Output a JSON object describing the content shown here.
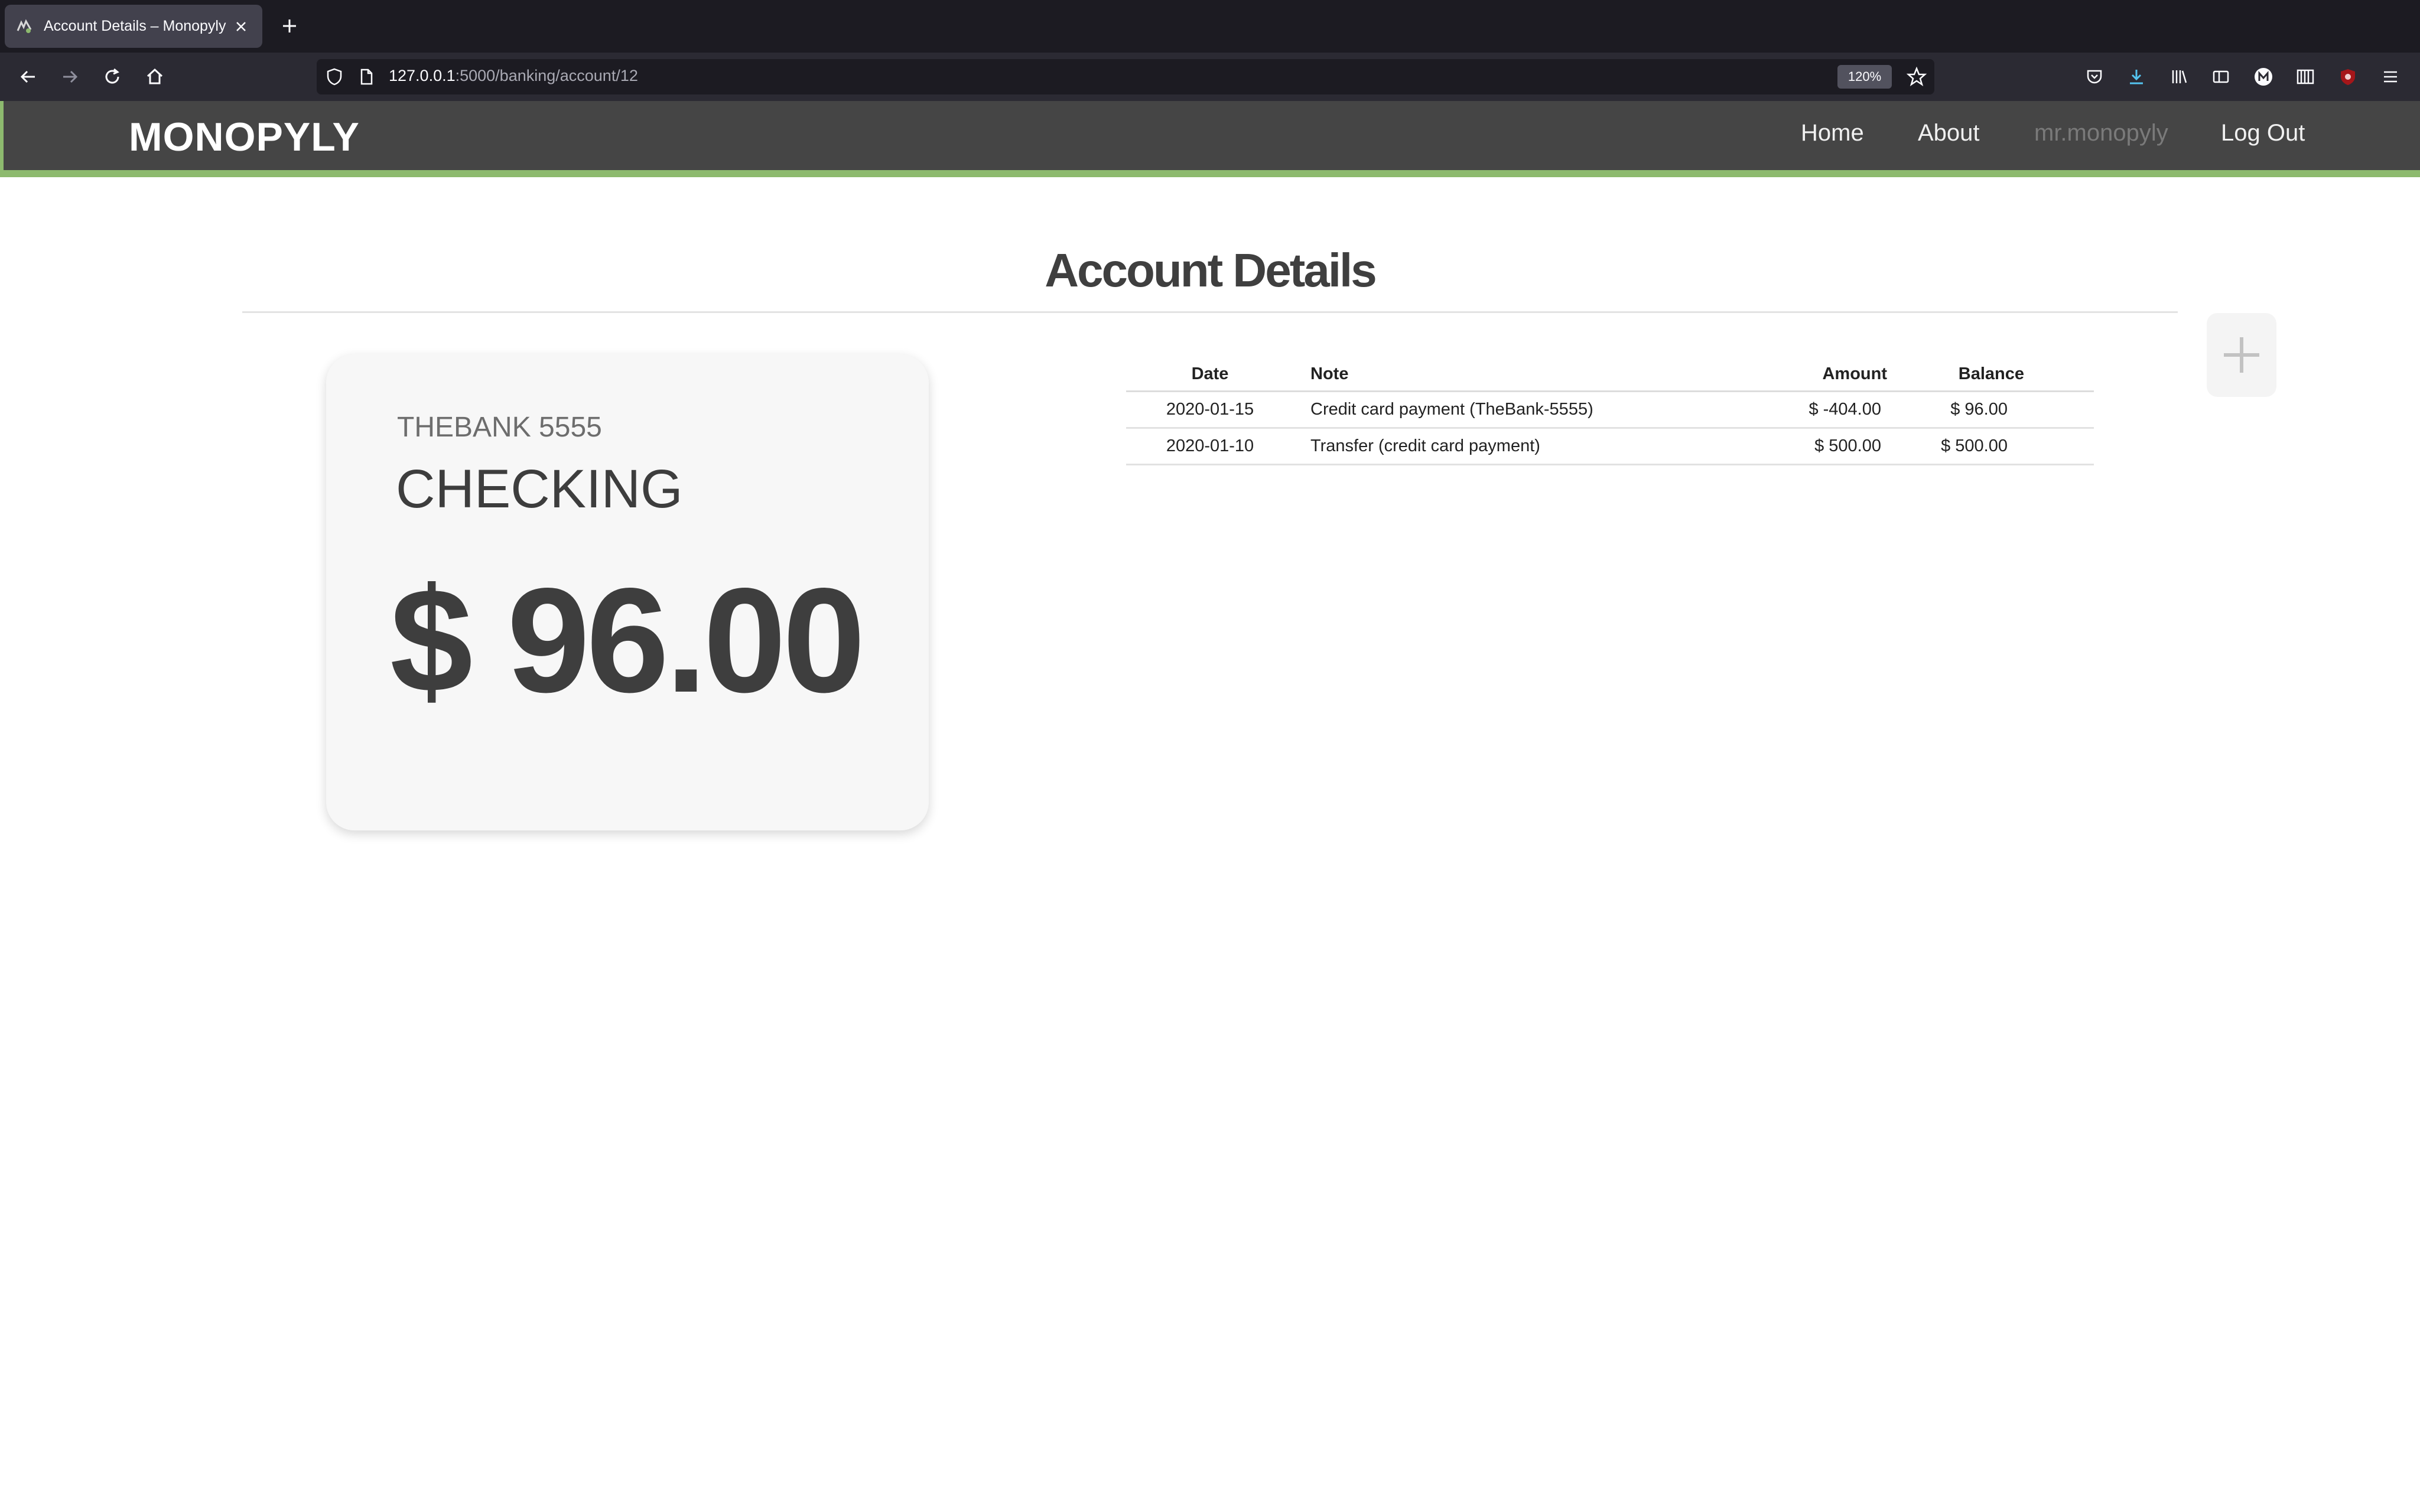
{
  "browser": {
    "tab_title": "Account Details – Monopyly",
    "url_host": "127.0.0.1",
    "url_path": ":5000/banking/account/12",
    "zoom": "120%"
  },
  "site": {
    "brand": "MONOPYLY",
    "nav": {
      "home": "Home",
      "about": "About",
      "user": "mr.monopyly",
      "logout": "Log Out"
    }
  },
  "page": {
    "title": "Account Details"
  },
  "account": {
    "bank": "THEBANK 5555",
    "type": "CHECKING",
    "balance": "$ 96.00"
  },
  "transactions": {
    "headers": {
      "date": "Date",
      "note": "Note",
      "amount": "Amount",
      "balance": "Balance"
    },
    "rows": [
      {
        "date": "2020-01-15",
        "note": "Credit card payment (TheBank-5555)",
        "amount": "$ -404.00",
        "balance": "$ 96.00"
      },
      {
        "date": "2020-01-10",
        "note": "Transfer (credit card payment)",
        "amount": "$ 500.00",
        "balance": "$ 500.00"
      }
    ]
  },
  "colors": {
    "header_bg": "#454545",
    "accent_green": "#8dba6e",
    "card_bg": "#f7f7f7"
  }
}
